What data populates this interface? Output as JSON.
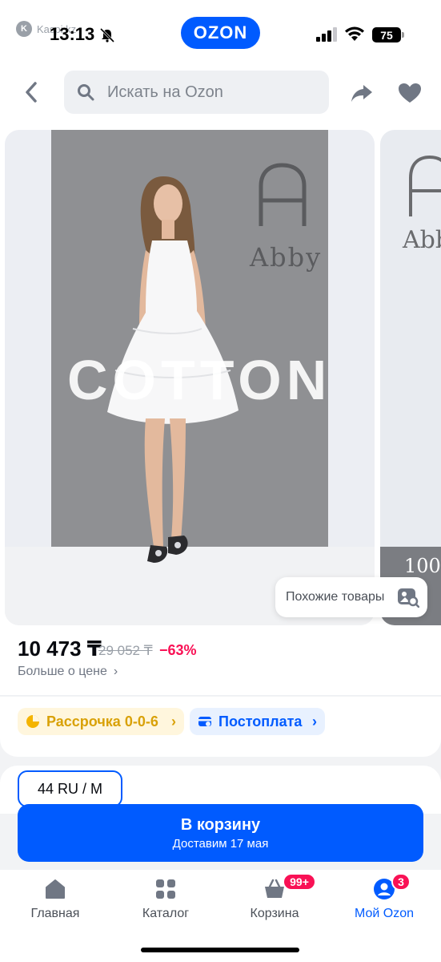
{
  "status_bar": {
    "watermark": "Kaspi.kz",
    "time": "13:13",
    "battery": "75",
    "logo": "OZON"
  },
  "header": {
    "search_placeholder": "Искать на Ozon",
    "icons": [
      "chevron-left-icon",
      "search-icon",
      "share-icon",
      "heart-icon"
    ]
  },
  "gallery": {
    "overlay_text": "COTTON",
    "brand": "Abby",
    "next_slide_brand": "Abby",
    "next_slide_text": "100",
    "similar_button": "Похожие товары"
  },
  "price": {
    "current": "10 473 ₸",
    "old": "29 052 ₸",
    "discount": "−63%",
    "more_link": "Больше о цене"
  },
  "payment": {
    "installment": "Рассрочка 0-0-6",
    "postpay": "Постоплата"
  },
  "size": {
    "selected": "44 RU / M"
  },
  "cart_button": {
    "label": "В корзину",
    "delivery": "Доставим 17 мая"
  },
  "tabbar": {
    "items": [
      {
        "label": "Главная",
        "icon": "home-icon"
      },
      {
        "label": "Каталог",
        "icon": "grid-icon"
      },
      {
        "label": "Корзина",
        "icon": "basket-icon",
        "badge": "99+"
      },
      {
        "label": "Мой Ozon",
        "icon": "profile-icon",
        "badge": "3"
      }
    ]
  },
  "colors": {
    "accent": "#005bff",
    "discount": "#f91155",
    "installment": "#d9a108"
  }
}
